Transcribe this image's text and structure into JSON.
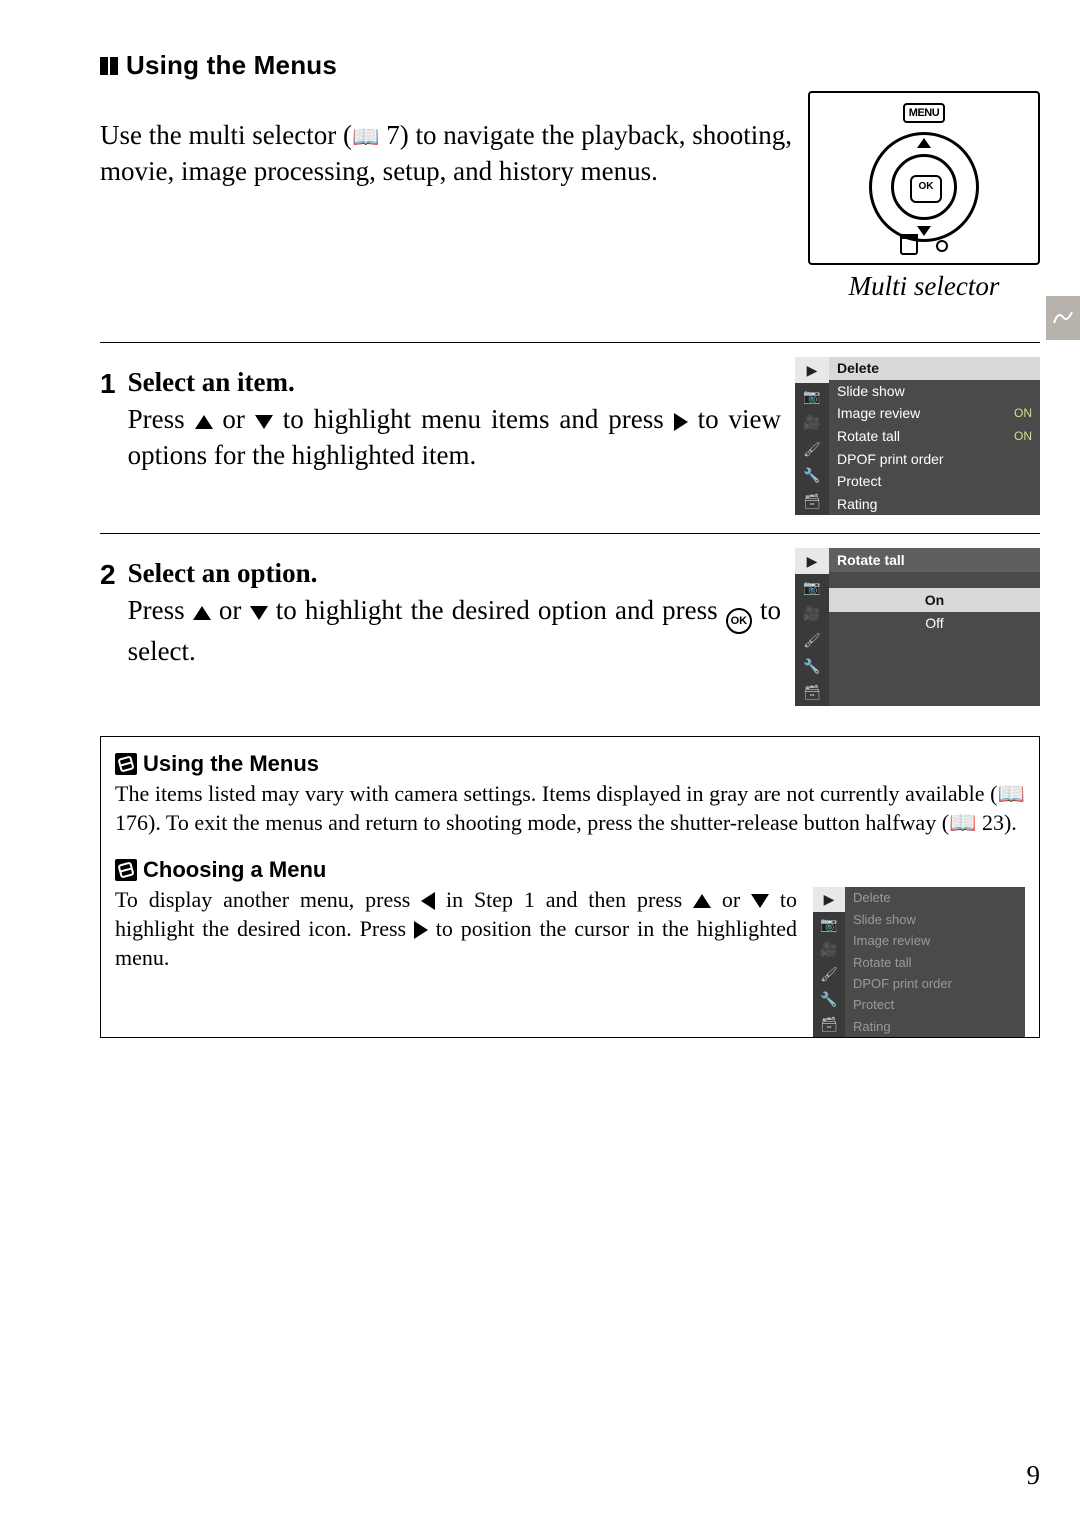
{
  "heading1": {
    "title": "Using the Menus"
  },
  "intro": {
    "text_a": "Use the multi selector (",
    "text_b": " 7) to navigate the playback, shooting, movie, image processing, setup, and history menus."
  },
  "ms": {
    "menu_label": "MENU",
    "ok": "OK",
    "caption": "Multi selector"
  },
  "step1": {
    "num": "1",
    "title": "Select an item.",
    "a": "Press ",
    "b": " or ",
    "c": " to highlight menu items and press ",
    "d": " to view options for the highlighted item."
  },
  "cam1": {
    "items": [
      {
        "label": "Delete",
        "v": "",
        "sel": true
      },
      {
        "label": "Slide show",
        "v": ""
      },
      {
        "label": "Image review",
        "v": "ON"
      },
      {
        "label": "Rotate tall",
        "v": "ON"
      },
      {
        "label": "DPOF print order",
        "v": ""
      },
      {
        "label": "Protect",
        "v": ""
      },
      {
        "label": "Rating",
        "v": ""
      }
    ]
  },
  "step2": {
    "num": "2",
    "title": "Select an option.",
    "a": "Press ",
    "b": " or ",
    "c": " to highlight the desired option and press ",
    "d": " to select."
  },
  "cam2": {
    "header": "Rotate tall",
    "opts": [
      {
        "label": "On",
        "sel": true
      },
      {
        "label": "Off"
      }
    ]
  },
  "box": {
    "h1": "Using the Menus",
    "p1a": "The items listed may vary with camera settings.  Items displayed in gray are not currently available (",
    "p1b": " 176). To exit the menus and return to shooting mode, press the shutter-release button halfway (",
    "p1c": " 23).",
    "h2": "Choosing a Menu",
    "p2a": "To display another menu, press ",
    "p2b": " in Step 1 and then press ",
    "p2c": " or ",
    "p2d": " to highlight the desired icon. Press ",
    "p2e": " to position the cursor in the highlighted menu."
  },
  "cam3": {
    "items": [
      {
        "label": "Delete"
      },
      {
        "label": "Slide show"
      },
      {
        "label": "Image review"
      },
      {
        "label": "Rotate tall"
      },
      {
        "label": "DPOF print order"
      },
      {
        "label": "Protect"
      },
      {
        "label": "Rating"
      }
    ]
  },
  "page_num": "9"
}
